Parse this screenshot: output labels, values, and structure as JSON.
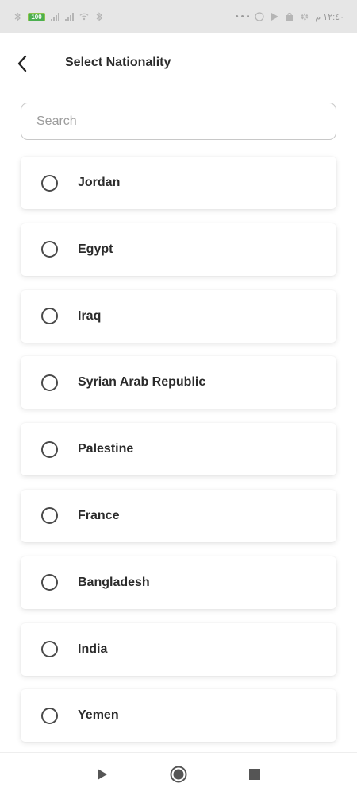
{
  "status_bar": {
    "battery": "100",
    "time": "١٢:٤٠ م"
  },
  "header": {
    "title": "Select Nationality"
  },
  "search": {
    "placeholder": "Search",
    "value": ""
  },
  "nationalities": [
    {
      "label": "Jordan",
      "selected": false
    },
    {
      "label": "Egypt",
      "selected": false
    },
    {
      "label": "Iraq",
      "selected": false
    },
    {
      "label": "Syrian Arab Republic",
      "selected": false
    },
    {
      "label": "Palestine",
      "selected": false
    },
    {
      "label": "France",
      "selected": false
    },
    {
      "label": "Bangladesh",
      "selected": false
    },
    {
      "label": "India",
      "selected": false
    },
    {
      "label": "Yemen",
      "selected": false
    }
  ],
  "nav_bar": {
    "icons": [
      "back-triangle-icon",
      "home-circle-icon",
      "recents-square-icon"
    ]
  }
}
